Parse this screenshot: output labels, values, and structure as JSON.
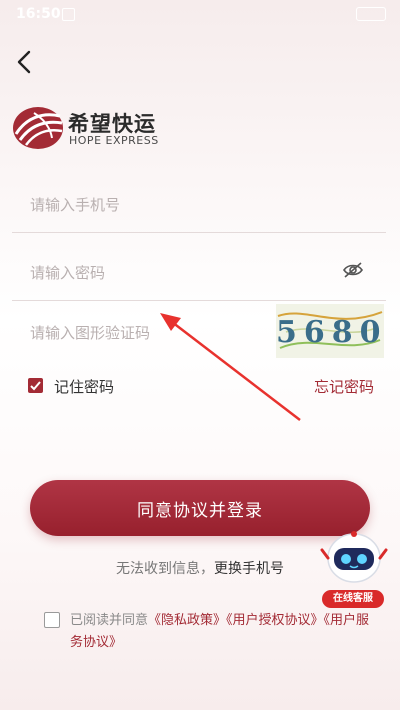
{
  "status_bar": {
    "time": "16:50"
  },
  "logo": {
    "cn": "希望快运",
    "en": "HOPE EXPRESS"
  },
  "form": {
    "phone_placeholder": "请输入手机号",
    "password_placeholder": "请输入密码",
    "captcha_placeholder": "请输入图形验证码",
    "captcha_code": "5680"
  },
  "remember": {
    "label": "记住密码",
    "checked": true
  },
  "forgot_label": "忘记密码",
  "login_button": "同意协议并登录",
  "no_sms": {
    "prefix": "无法收到信息，",
    "link": "更换手机号"
  },
  "agreement": {
    "prefix": "已阅读并同意",
    "privacy": "《隐私政策》",
    "authorization": "《用户授权协议》",
    "service": "《用户服务协议》"
  },
  "support_bot": {
    "label": "在线客服"
  },
  "colors": {
    "brand": "#a32b35",
    "accent_red": "#d92a2a"
  }
}
